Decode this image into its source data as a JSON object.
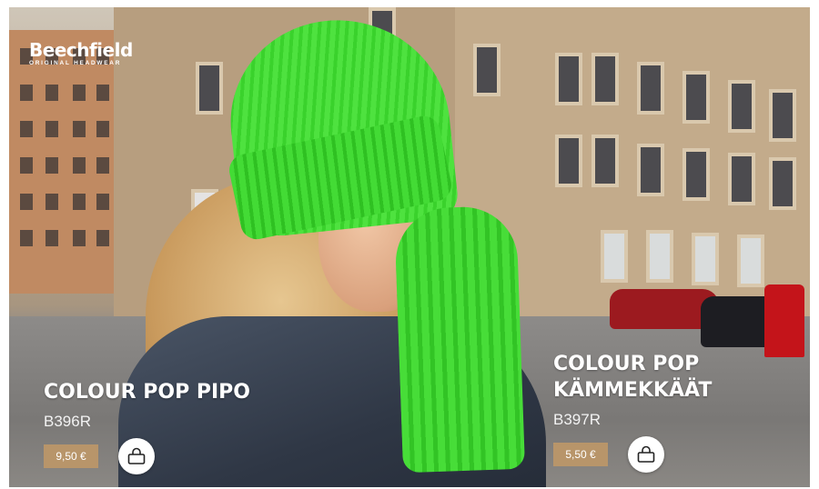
{
  "brand": {
    "name": "Beechfield",
    "tagline": "ORIGINAL HEADWEAR"
  },
  "products": [
    {
      "title_lines": [
        "COLOUR POP PIPO"
      ],
      "code": "B396R",
      "price": "9,50 €",
      "cart_icon": "shopping-bag-icon"
    },
    {
      "title_lines": [
        "COLOUR POP",
        "KÄMMEKKÄÄT"
      ],
      "code": "B397R",
      "price": "5,50 €",
      "cart_icon": "shopping-bag-icon"
    }
  ],
  "colors": {
    "price_badge": "#b8956a",
    "text": "#ffffff",
    "accent_green": "#3ad22c"
  }
}
